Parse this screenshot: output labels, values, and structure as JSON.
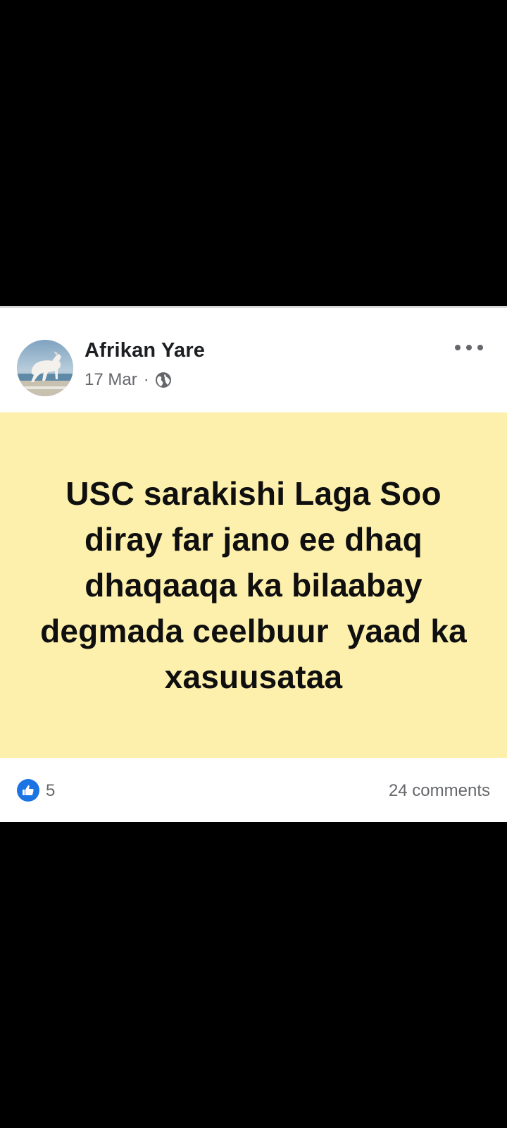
{
  "post": {
    "author": "Afrikan Yare",
    "date": "17 Mar",
    "meta_separator": "·",
    "privacy_icon": "globe-icon",
    "more_icon": "more-options-icon",
    "text": "USC sarakishi Laga Soo diray far jano ee dhaq dhaqaaqa ka bilaabay degmada ceelbuur  yaad ka xasuusataa",
    "background_color": "#fdf0ac",
    "reactions": {
      "icon": "like-icon",
      "count": "5"
    },
    "comments": "24 comments"
  },
  "colors": {
    "screen_background": "#000000",
    "card_background": "#ffffff",
    "like_blue": "#1b74e4",
    "secondary_text": "#65676b"
  }
}
